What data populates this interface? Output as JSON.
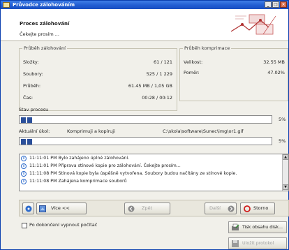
{
  "window": {
    "title": "Průvodce zálohováním",
    "controls": [
      "_",
      "□",
      "×"
    ]
  },
  "header": {
    "title": "Proces zálohování",
    "subtitle": "Čekejte prosím ..."
  },
  "backup_progress": {
    "legend": "Průběh zálohování",
    "rows": [
      {
        "label": "Složky:",
        "value": "61 / 121"
      },
      {
        "label": "Soubory:",
        "value": "525 / 1 229"
      },
      {
        "label": "Průběh:",
        "value": "61.45 MB / 1,05 GB"
      },
      {
        "label": "Čas:",
        "value": "00:28 / 00:12"
      }
    ]
  },
  "compression_progress": {
    "legend": "Průběh komprimace",
    "rows": [
      {
        "label": "Velikost:",
        "value": "32.55 MB"
      },
      {
        "label": "Poměr:",
        "value": "47.02%"
      }
    ]
  },
  "process_status": {
    "label": "Stav procesu",
    "progress": 0.05,
    "percent_text": "5%"
  },
  "current_action": {
    "label": "Aktuální úkol:",
    "action": "Komprimuji a kopíruji",
    "path": "C:\\skola\\software\\Sunec\\img\\or1.gif",
    "progress": 0.05,
    "percent_text": "5%"
  },
  "log": [
    {
      "icon": "info-icon",
      "text": "11:11:01 PM Bylo zahájeno úplné zálohování."
    },
    {
      "icon": "info-icon",
      "text": "11:11:01 PM Příprava stínové kopie pro zálohování. Čekejte prosím..."
    },
    {
      "icon": "info-icon",
      "text": "11:11:08 PM Stínová kopie byla úspěšně vytvořena. Soubory budou načítány ze stínové kopie."
    },
    {
      "icon": "info-icon",
      "text": "11:11:08 PM Zahájena komprimace souborů"
    }
  ],
  "buttons": {
    "more": "Více <<",
    "back": "Zpět",
    "next": "Další",
    "stop": "Storno",
    "print_log": "Tisk obsahu disk...",
    "save_log": "Uložit protokol"
  },
  "shutdown_checkbox": {
    "label": "Po dokončení vypnout počítač",
    "checked": false
  },
  "colors": {
    "titlebar": "#1f5bd0",
    "progress_fill": "#2a4f9a",
    "stop_icon": "#d02020"
  }
}
